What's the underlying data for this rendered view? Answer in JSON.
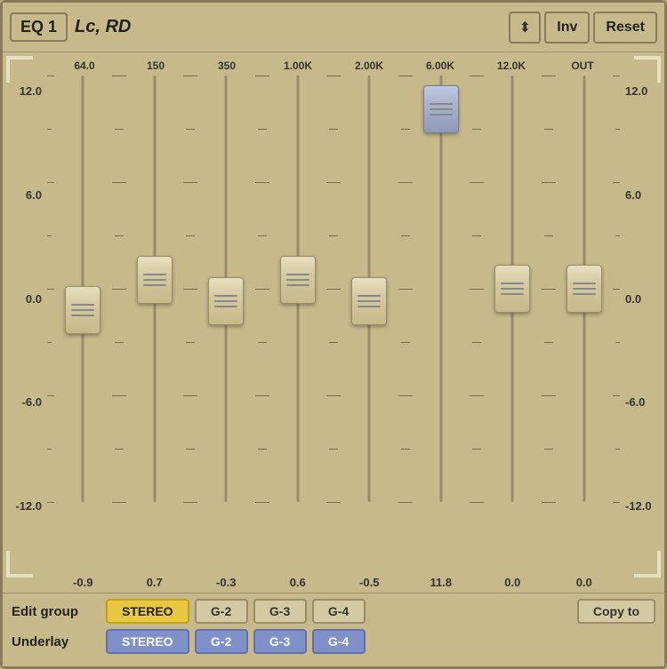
{
  "header": {
    "eq_label": "EQ 1",
    "channel": "Lc, RD",
    "arrow_symbol": "⬍",
    "inv_label": "Inv",
    "reset_label": "Reset"
  },
  "freq_labels": [
    "64.0",
    "150",
    "350",
    "1.00K",
    "2.00K",
    "6.00K",
    "12.0K",
    "OUT"
  ],
  "scale": {
    "left": [
      "12.0",
      "6.0",
      "0.0",
      "-6.0",
      "-12.0"
    ],
    "right": [
      "12.0",
      "6.0",
      "0.0",
      "-6.0",
      "-12.0"
    ]
  },
  "channels": [
    {
      "freq": "64.0",
      "value": "-0.9",
      "position": 55,
      "active": false
    },
    {
      "freq": "150",
      "value": "0.7",
      "position": 48,
      "active": false
    },
    {
      "freq": "350",
      "value": "-0.3",
      "position": 53,
      "active": false
    },
    {
      "freq": "1.00K",
      "value": "0.6",
      "position": 48,
      "active": false
    },
    {
      "freq": "2.00K",
      "value": "-0.5",
      "position": 53,
      "active": false
    },
    {
      "freq": "6.00K",
      "value": "11.8",
      "position": 8,
      "active": true
    },
    {
      "freq": "12.0K",
      "value": "0.0",
      "position": 50,
      "active": false
    },
    {
      "freq": "OUT",
      "value": "0.0",
      "position": 50,
      "active": false,
      "is_out": true
    }
  ],
  "edit_group": {
    "label": "Edit group",
    "buttons": [
      "STEREO",
      "G-2",
      "G-3",
      "G-4"
    ],
    "active_index": 0,
    "copy_to_label": "Copy to"
  },
  "underlay": {
    "label": "Underlay",
    "buttons": [
      "STEREO",
      "G-2",
      "G-3",
      "G-4"
    ],
    "active_indices": [
      0,
      1,
      2,
      3
    ]
  }
}
